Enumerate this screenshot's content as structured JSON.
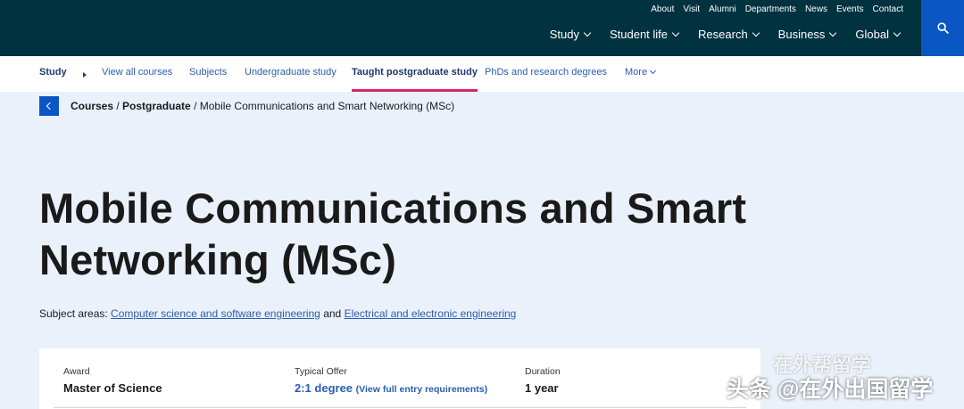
{
  "header": {
    "utility_links": [
      "About",
      "Visit",
      "Alumni",
      "Departments",
      "News",
      "Events",
      "Contact"
    ],
    "main_nav": [
      "Study",
      "Student life",
      "Research",
      "Business",
      "Global"
    ],
    "colors": {
      "header_bg": "#00323f",
      "accent_blue": "#0a56c2",
      "active_underline": "#d6246e",
      "page_bg": "#eaf1fb"
    },
    "search_icon": "search-icon"
  },
  "subnav": {
    "section": "Study",
    "items": [
      "View all courses",
      "Subjects",
      "Undergraduate study",
      "Taught postgraduate study",
      "PhDs and research degrees"
    ],
    "active": "Taught postgraduate study",
    "more": "More"
  },
  "breadcrumb": {
    "courses": "Courses",
    "sep": " / ",
    "postgraduate": "Postgraduate",
    "current": "Mobile Communications and Smart Networking (MSc)"
  },
  "page": {
    "title_line1": "Mobile Communications and Smart",
    "title_line2": "Networking (MSc)",
    "subject_prefix": "Subject areas: ",
    "subject_1": "Computer science and software engineering",
    "subject_and": " and ",
    "subject_2": "Electrical and electronic engineering"
  },
  "summary": {
    "award_label": "Award",
    "award_value": "Master of Science",
    "offer_label": "Typical Offer",
    "offer_value": "2:1 degree",
    "offer_link": "(View full entry requirements)",
    "duration_label": "Duration",
    "duration_value": "1 year"
  },
  "watermark": {
    "line1": "在外帮留学",
    "line2": "头条 @在外出国留学"
  }
}
